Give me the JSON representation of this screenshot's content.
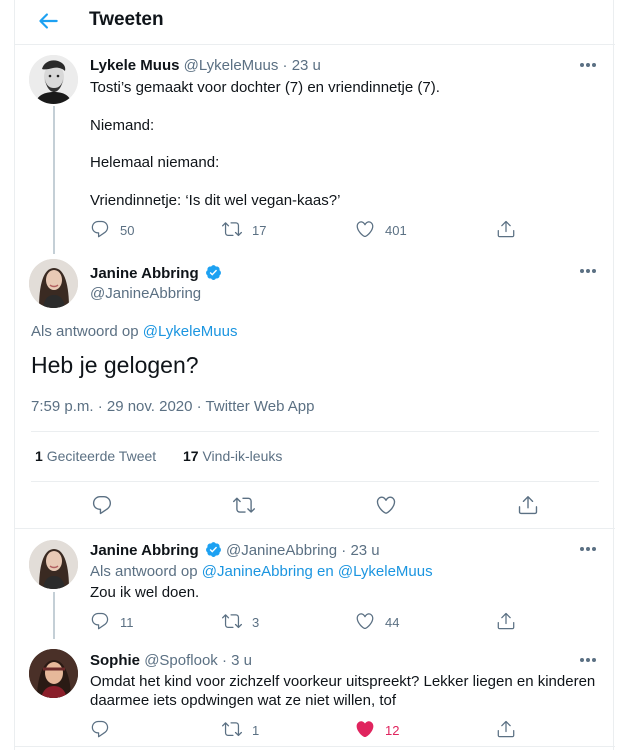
{
  "header": {
    "title": "Tweeten"
  },
  "tweet1": {
    "name": "Lykele Muus",
    "handle": "@LykeleMuus",
    "time": "· 23 u",
    "lines": [
      "Tosti’s gemaakt voor dochter (7) en vriendinnetje (7).",
      "Niemand:",
      "Helemaal niemand:",
      "Vriendinnetje: ‘Is dit wel vegan-kaas?’"
    ],
    "replies": "50",
    "retweets": "17",
    "likes": "401"
  },
  "focus": {
    "name": "Janine Abbring",
    "handle": "@JanineAbbring",
    "reply_prefix": "Als antwoord op",
    "reply_to": "@LykeleMuus",
    "text": "Heb je gelogen?",
    "meta": "7:59 p.m. · 29 nov. 2020 · Twitter Web App",
    "quote_count": "1",
    "quote_label": "Geciteerde Tweet",
    "like_count": "17",
    "like_label": "Vind-ik-leuks"
  },
  "reply1": {
    "name": "Janine Abbring",
    "handle": "@JanineAbbring",
    "time": "· 23 u",
    "reply_prefix": "Als antwoord op",
    "reply_to": "@JanineAbbring en @LykeleMuus",
    "text": "Zou ik wel doen.",
    "replies": "11",
    "retweets": "3",
    "likes": "44"
  },
  "reply2": {
    "name": "Sophie",
    "handle": "@Spoflook",
    "time": "· 3 u",
    "lines": [
      "Omdat het kind voor zichzelf voorkeur uitspreekt? Lekker liegen en kinderen",
      "daarmee iets opdwingen wat ze niet willen, tof"
    ],
    "retweets": "1",
    "likes": "12"
  },
  "colors": {
    "accent": "#1da1f2",
    "link": "#1b95e0",
    "muted": "#5b7083",
    "like": "#e0245e",
    "verified": "#1da1f2"
  },
  "icons": [
    "back-arrow-icon",
    "more-icon",
    "reply-icon",
    "retweet-icon",
    "heart-icon",
    "heart-filled-icon",
    "share-icon",
    "verified-badge-icon"
  ]
}
